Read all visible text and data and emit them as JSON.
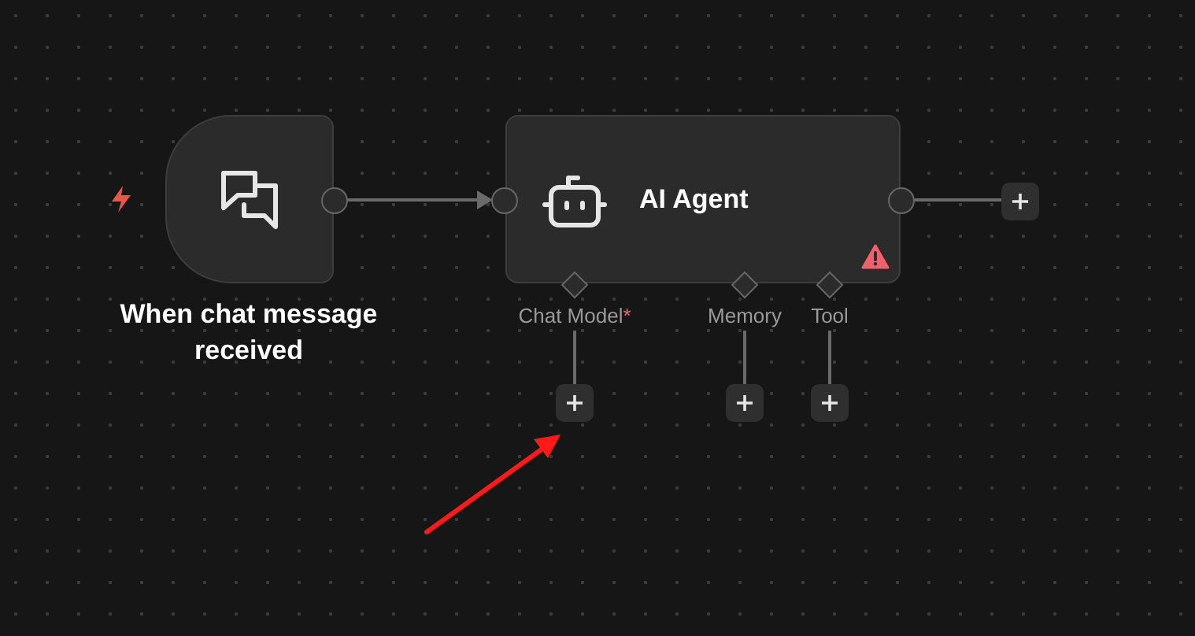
{
  "trigger": {
    "title": "When chat message received"
  },
  "agent": {
    "title": "AI Agent",
    "warning": true
  },
  "sub_inputs": [
    {
      "label": "Chat Model",
      "required_mark": "*"
    },
    {
      "label": "Memory"
    },
    {
      "label": "Tool"
    }
  ]
}
